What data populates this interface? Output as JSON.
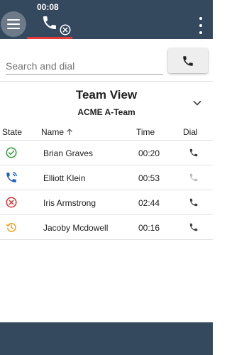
{
  "header": {
    "call_timer": "00:08",
    "icons": {
      "menu": "menu-icon",
      "call": "phone-icon",
      "hangup": "close-circle-icon",
      "more": "more-vert-icon"
    },
    "accent_color": "#e53935",
    "bar_color": "#34495e"
  },
  "search": {
    "placeholder": "Search and dial",
    "value": ""
  },
  "team": {
    "title": "Team View",
    "name": "ACME A-Team"
  },
  "table": {
    "columns": [
      "State",
      "Name",
      "Time",
      "Dial"
    ],
    "sort_column": "Name",
    "sort_direction": "ascending",
    "rows": [
      {
        "state": "available",
        "state_icon": "check-circle-icon",
        "state_color": "#2e9d3a",
        "name": "Brian Graves",
        "time": "00:20",
        "dial_enabled": true
      },
      {
        "state": "on-call",
        "state_icon": "phone-in-talk-icon",
        "state_color": "#1e5fc8",
        "name": "Elliott Klein",
        "time": "00:53",
        "dial_enabled": false
      },
      {
        "state": "unavailable",
        "state_icon": "x-circle-icon",
        "state_color": "#d32f2f",
        "name": "Iris Armstrong",
        "time": "02:44",
        "dial_enabled": true
      },
      {
        "state": "wrap-up",
        "state_icon": "history-icon",
        "state_color": "#f0a020",
        "name": "Jacoby Mcdowell",
        "time": "00:16",
        "dial_enabled": true
      }
    ]
  }
}
